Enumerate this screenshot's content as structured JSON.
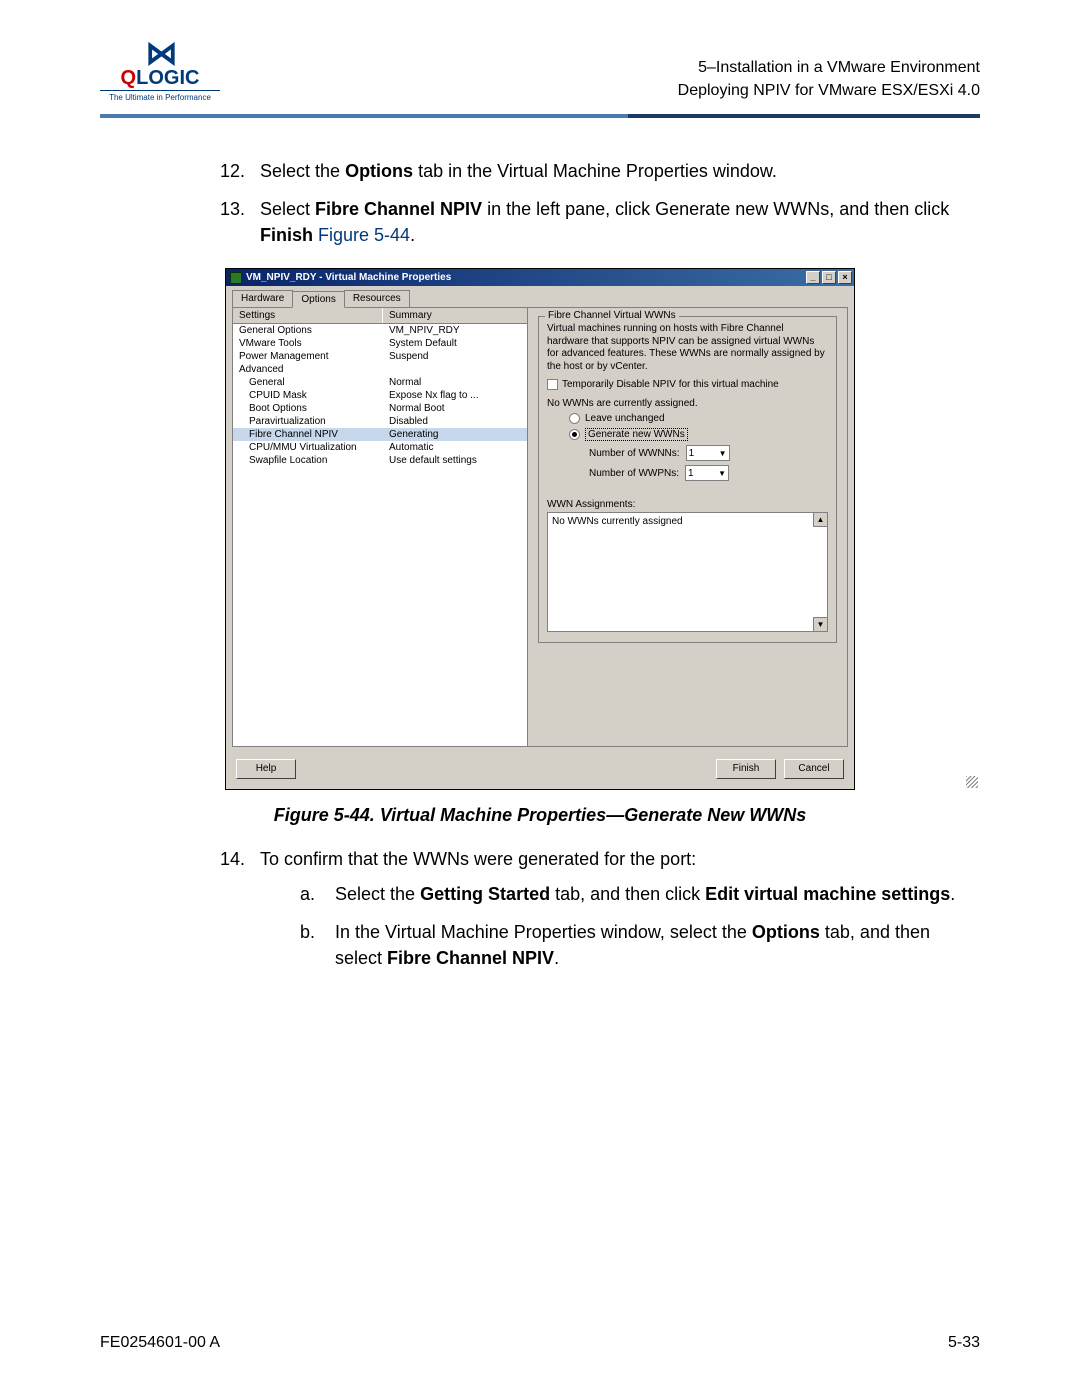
{
  "header": {
    "logo_name": "QLOGIC",
    "logo_tagline": "The Ultimate in Performance",
    "line1": "5–Installation in a VMware Environment",
    "line2": "Deploying NPIV for VMware ESX/ESXi 4.0"
  },
  "steps": {
    "s12_num": "12.",
    "s12_a": "Select the ",
    "s12_b": "Options",
    "s12_c": " tab in the Virtual Machine Properties window.",
    "s13_num": "13.",
    "s13_a": "Select ",
    "s13_b": "Fibre Channel NPIV",
    "s13_c": " in the left pane, click Generate new WWNs, and then click ",
    "s13_d": "Finish",
    "s13_e": " ",
    "s13_link": "Figure 5-44",
    "s13_f": ".",
    "s14_num": "14.",
    "s14_text": "To confirm that the WWNs were generated for the port:",
    "s14a_letter": "a.",
    "s14a_a": "Select the ",
    "s14a_b": "Getting Started",
    "s14a_c": " tab, and then click ",
    "s14a_d": "Edit virtual machine settings",
    "s14a_e": ".",
    "s14b_letter": "b.",
    "s14b_a": "In the Virtual Machine Properties window, select the ",
    "s14b_b": "Options",
    "s14b_c": " tab, and then select ",
    "s14b_d": "Fibre Channel NPIV",
    "s14b_e": "."
  },
  "figure_caption": "Figure 5-44. Virtual Machine Properties—Generate New WWNs",
  "footer": {
    "left": "FE0254601-00 A",
    "right": "5-33"
  },
  "dialog": {
    "title": "VM_NPIV_RDY - Virtual Machine Properties",
    "tabs": {
      "hardware": "Hardware",
      "options": "Options",
      "resources": "Resources"
    },
    "cols": {
      "settings": "Settings",
      "summary": "Summary"
    },
    "rows": [
      {
        "c1": "General Options",
        "c2": "VM_NPIV_RDY"
      },
      {
        "c1": "VMware Tools",
        "c2": "System Default"
      },
      {
        "c1": "Power Management",
        "c2": "Suspend"
      },
      {
        "c1": "Advanced",
        "c2": ""
      },
      {
        "c1": "General",
        "c2": "Normal",
        "indent": true
      },
      {
        "c1": "CPUID Mask",
        "c2": "Expose Nx flag to ...",
        "indent": true
      },
      {
        "c1": "Boot Options",
        "c2": "Normal Boot",
        "indent": true
      },
      {
        "c1": "Paravirtualization",
        "c2": "Disabled",
        "indent": true
      },
      {
        "c1": "Fibre Channel NPIV",
        "c2": "Generating",
        "indent": true,
        "selected": true
      },
      {
        "c1": "CPU/MMU Virtualization",
        "c2": "Automatic",
        "indent": true
      },
      {
        "c1": "Swapfile Location",
        "c2": "Use default settings",
        "indent": true
      }
    ],
    "group_title": "Fibre Channel Virtual WWNs",
    "desc": "Virtual machines running on hosts with Fibre Channel hardware that supports NPIV can be assigned virtual WWNs for advanced features. These WWNs are normally assigned by the host or by vCenter.",
    "chk_label": "Temporarily Disable NPIV for this virtual machine",
    "no_wwns": "No WWNs are currently assigned.",
    "radio_leave": "Leave unchanged",
    "radio_gen": "Generate new WWNs",
    "num_wwnn": "Number of WWNNs:",
    "num_wwpn": "Number of WWPNs:",
    "num_val1": "1",
    "num_val2": "1",
    "assign_label": "WWN Assignments:",
    "assign_text": "No WWNs currently assigned",
    "btn_help": "Help",
    "btn_finish": "Finish",
    "btn_cancel": "Cancel"
  }
}
